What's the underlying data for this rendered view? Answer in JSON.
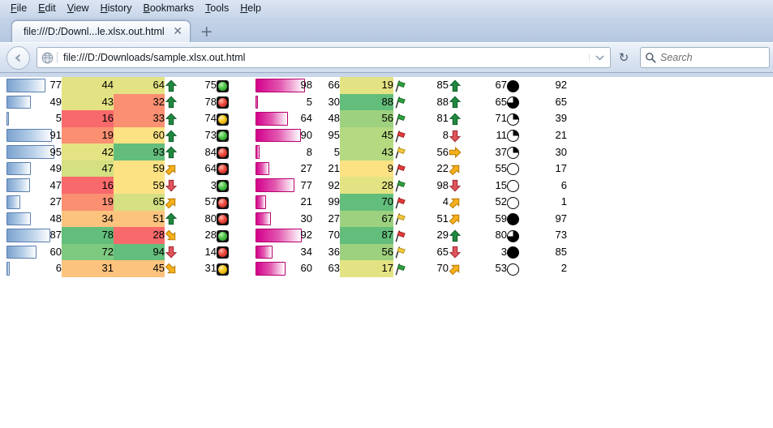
{
  "browser": {
    "menu_items": [
      "File",
      "Edit",
      "View",
      "History",
      "Bookmarks",
      "Tools",
      "Help"
    ],
    "tab_title": "file:///D:/Downl...le.xlsx.out.html",
    "tab_close_label": "✕",
    "new_tab_label": "+",
    "url": "file:///D:/Downloads/sample.xlsx.out.html",
    "search_placeholder": "Search",
    "reload_label": "↻",
    "back_icon": "back-arrow-icon",
    "site_icon": "globe-icon",
    "dropdown_icon": "chevron-down-icon",
    "search_icon": "search-icon"
  },
  "colors": {
    "bar_blue": "#7ba2cf",
    "bar_blue_border": "#5a7fae",
    "bar_pink": "#d4008c",
    "bar_pink_border": "#b5006e",
    "scale_red": "#f8696b",
    "scale_salmon": "#fa8f72",
    "scale_orange": "#fcc37e",
    "scale_yellow": "#fce283",
    "scale_lemon": "#e4e383",
    "scale_lime": "#c4dc81",
    "scale_green": "#63be7b",
    "arrow_green": "#21883f",
    "arrow_amber": "#f6b11a",
    "arrow_red": "#e0545a",
    "flag_green": "#2f9e3e",
    "flag_red": "#e03a3a",
    "flag_yellow": "#f2c740"
  },
  "sheet": {
    "row_count": 12,
    "columns": [
      {
        "name": "data-bar-blue",
        "type": "databar",
        "color": "blue"
      },
      {
        "name": "color-scale-a",
        "type": "colorscale"
      },
      {
        "name": "color-scale-b",
        "type": "colorscale"
      },
      {
        "name": "icon-arrows-1",
        "type": "icon",
        "icon_set": "arrows"
      },
      {
        "name": "traffic-light-values",
        "type": "number"
      },
      {
        "name": "icon-traffic-lights",
        "type": "icon",
        "icon_set": "traffic-lights"
      },
      {
        "name": "data-bar-pink",
        "type": "databar",
        "color": "pink"
      },
      {
        "name": "plain-numbers-a",
        "type": "number"
      },
      {
        "name": "color-scale-c",
        "type": "colorscale"
      },
      {
        "name": "icon-flags",
        "type": "icon",
        "icon_set": "flags"
      },
      {
        "name": "arrow-values-2",
        "type": "number"
      },
      {
        "name": "icon-arrows-2",
        "type": "icon",
        "icon_set": "arrows"
      },
      {
        "name": "pie-values",
        "type": "number"
      },
      {
        "name": "icon-pies",
        "type": "icon",
        "icon_set": "pies"
      },
      {
        "name": "plain-numbers-b",
        "type": "number"
      }
    ],
    "rows": [
      {
        "bar_blue": 77,
        "scale_a": 44,
        "scale_a_color": "#e4e383",
        "scale_b": 64,
        "scale_b_color": "#e4e383",
        "arrow1": "up",
        "tl_value": 75,
        "traffic": "green",
        "bar_pink": 98,
        "num_a": 66,
        "scale_c": 19,
        "scale_c_color": "#e4e383",
        "flag": "green",
        "arrow2_value": 85,
        "arrow2": "up",
        "pie_value": 67,
        "pie": "full",
        "num_b": 92
      },
      {
        "bar_blue": 49,
        "scale_a": 43,
        "scale_a_color": "#e4e383",
        "scale_b": 32,
        "scale_b_color": "#fa8f72",
        "arrow1": "up",
        "tl_value": 78,
        "traffic": "red",
        "bar_pink": 5,
        "num_a": 30,
        "scale_c": 88,
        "scale_c_color": "#63be7b",
        "flag": "green",
        "arrow2_value": 88,
        "arrow2": "up",
        "pie_value": 65,
        "pie": "three",
        "num_b": 65
      },
      {
        "bar_blue": 5,
        "scale_a": 16,
        "scale_a_color": "#f8696b",
        "scale_b": 33,
        "scale_b_color": "#fa8f72",
        "arrow1": "up",
        "tl_value": 74,
        "traffic": "yellow",
        "bar_pink": 64,
        "num_a": 48,
        "scale_c": 56,
        "scale_c_color": "#9ed17f",
        "flag": "green",
        "arrow2_value": 81,
        "arrow2": "up",
        "pie_value": 71,
        "pie": "quarter",
        "num_b": 39
      },
      {
        "bar_blue": 91,
        "scale_a": 19,
        "scale_a_color": "#fa8f72",
        "scale_b": 60,
        "scale_b_color": "#fce283",
        "arrow1": "up",
        "tl_value": 73,
        "traffic": "green",
        "bar_pink": 90,
        "num_a": 95,
        "scale_c": 45,
        "scale_c_color": "#b4d980",
        "flag": "red",
        "arrow2_value": 8,
        "arrow2": "down",
        "pie_value": 11,
        "pie": "quarter",
        "num_b": 21
      },
      {
        "bar_blue": 95,
        "scale_a": 42,
        "scale_a_color": "#e4e383",
        "scale_b": 93,
        "scale_b_color": "#63be7b",
        "arrow1": "up",
        "tl_value": 84,
        "traffic": "red",
        "bar_pink": 8,
        "num_a": 5,
        "scale_c": 43,
        "scale_c_color": "#b4d980",
        "flag": "yellow",
        "arrow2_value": 56,
        "arrow2": "right",
        "pie_value": 37,
        "pie": "quarter",
        "num_b": 30
      },
      {
        "bar_blue": 49,
        "scale_a": 47,
        "scale_a_color": "#d4e082",
        "scale_b": 59,
        "scale_b_color": "#fce283",
        "arrow1": "up-right",
        "tl_value": 64,
        "traffic": "red",
        "bar_pink": 27,
        "num_a": 21,
        "scale_c": 9,
        "scale_c_color": "#fce283",
        "flag": "red",
        "arrow2_value": 22,
        "arrow2": "up-right",
        "pie_value": 55,
        "pie": "empty",
        "num_b": 17
      },
      {
        "bar_blue": 47,
        "scale_a": 16,
        "scale_a_color": "#f8696b",
        "scale_b": 59,
        "scale_b_color": "#fce283",
        "arrow1": "down",
        "tl_value": 3,
        "traffic": "green",
        "bar_pink": 77,
        "num_a": 92,
        "scale_c": 28,
        "scale_c_color": "#e4e383",
        "flag": "green",
        "arrow2_value": 98,
        "arrow2": "down",
        "pie_value": 15,
        "pie": "empty",
        "num_b": 6
      },
      {
        "bar_blue": 27,
        "scale_a": 19,
        "scale_a_color": "#fa8f72",
        "scale_b": 65,
        "scale_b_color": "#d4e082",
        "arrow1": "up-right",
        "tl_value": 57,
        "traffic": "red",
        "bar_pink": 21,
        "num_a": 99,
        "scale_c": 70,
        "scale_c_color": "#63be7b",
        "flag": "red",
        "arrow2_value": 4,
        "arrow2": "up-right",
        "pie_value": 52,
        "pie": "empty",
        "num_b": 1
      },
      {
        "bar_blue": 48,
        "scale_a": 34,
        "scale_a_color": "#fcc37e",
        "scale_b": 51,
        "scale_b_color": "#fcc37e",
        "arrow1": "up",
        "tl_value": 80,
        "traffic": "red",
        "bar_pink": 30,
        "num_a": 27,
        "scale_c": 67,
        "scale_c_color": "#9ed17f",
        "flag": "yellow",
        "arrow2_value": 51,
        "arrow2": "up-right",
        "pie_value": 59,
        "pie": "full",
        "num_b": 97
      },
      {
        "bar_blue": 87,
        "scale_a": 78,
        "scale_a_color": "#63be7b",
        "scale_b": 28,
        "scale_b_color": "#f8696b",
        "arrow1": "down-right",
        "tl_value": 28,
        "traffic": "green",
        "bar_pink": 92,
        "num_a": 70,
        "scale_c": 87,
        "scale_c_color": "#63be7b",
        "flag": "red",
        "arrow2_value": 29,
        "arrow2": "up",
        "pie_value": 80,
        "pie": "three",
        "num_b": 73
      },
      {
        "bar_blue": 60,
        "scale_a": 72,
        "scale_a_color": "#7ec980",
        "scale_b": 94,
        "scale_b_color": "#63be7b",
        "arrow1": "down",
        "tl_value": 14,
        "traffic": "red",
        "bar_pink": 34,
        "num_a": 36,
        "scale_c": 56,
        "scale_c_color": "#9ed17f",
        "flag": "yellow",
        "arrow2_value": 65,
        "arrow2": "down",
        "pie_value": 3,
        "pie": "full",
        "num_b": 85
      },
      {
        "bar_blue": 6,
        "scale_a": 31,
        "scale_a_color": "#fcc37e",
        "scale_b": 45,
        "scale_b_color": "#fcc37e",
        "arrow1": "down-right",
        "tl_value": 31,
        "traffic": "yellow",
        "bar_pink": 60,
        "num_a": 63,
        "scale_c": 17,
        "scale_c_color": "#e4e383",
        "flag": "green",
        "arrow2_value": 70,
        "arrow2": "up-right",
        "pie_value": 53,
        "pie": "empty",
        "num_b": 2
      }
    ]
  }
}
